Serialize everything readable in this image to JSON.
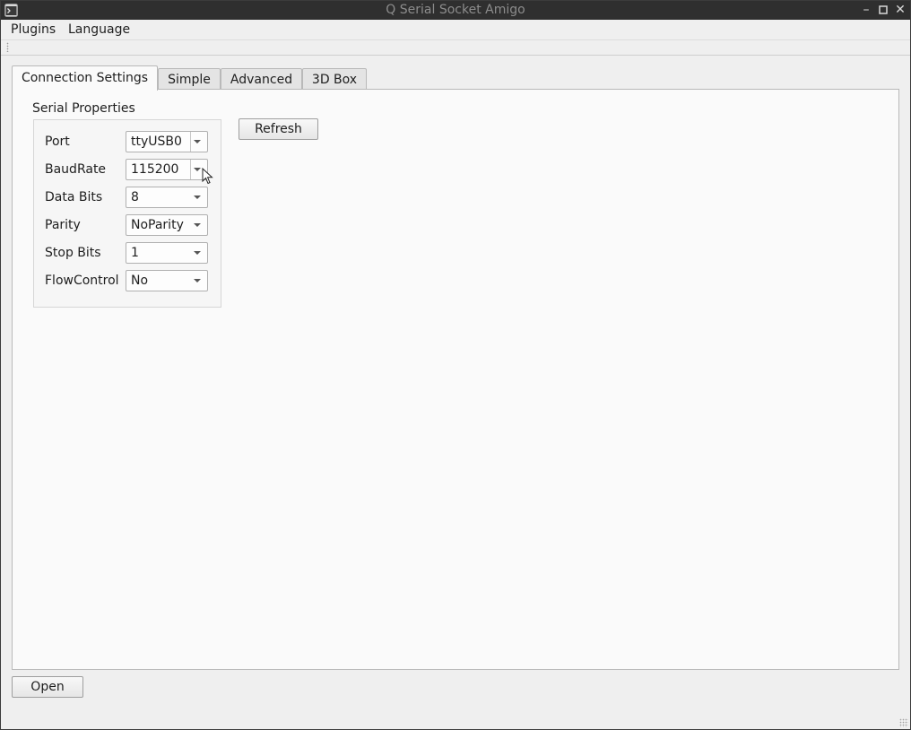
{
  "window": {
    "title": "Q Serial Socket Amigo"
  },
  "menubar": {
    "items": [
      {
        "label": "Plugins"
      },
      {
        "label": "Language"
      }
    ]
  },
  "tabs": [
    {
      "label": "Connection Settings",
      "active": true
    },
    {
      "label": "Simple",
      "active": false
    },
    {
      "label": "Advanced",
      "active": false
    },
    {
      "label": "3D Box",
      "active": false
    }
  ],
  "serial": {
    "group_title": "Serial Properties",
    "fields": [
      {
        "label": "Port",
        "value": "ttyUSB0"
      },
      {
        "label": "BaudRate",
        "value": "115200"
      },
      {
        "label": "Data Bits",
        "value": "8"
      },
      {
        "label": "Parity",
        "value": "NoParity"
      },
      {
        "label": "Stop Bits",
        "value": "1"
      },
      {
        "label": "FlowControl",
        "value": "No"
      }
    ],
    "refresh_label": "Refresh"
  },
  "footer": {
    "open_label": "Open"
  },
  "icons": {
    "app": "terminal-icon",
    "minimize": "minimize-icon",
    "maximize": "maximize-icon",
    "close": "close-icon",
    "cursor": "mouse-pointer-icon"
  },
  "colors": {
    "titlebar": "#2f2f2f",
    "window_bg": "#efefef",
    "panel_bg": "#fafafa"
  }
}
